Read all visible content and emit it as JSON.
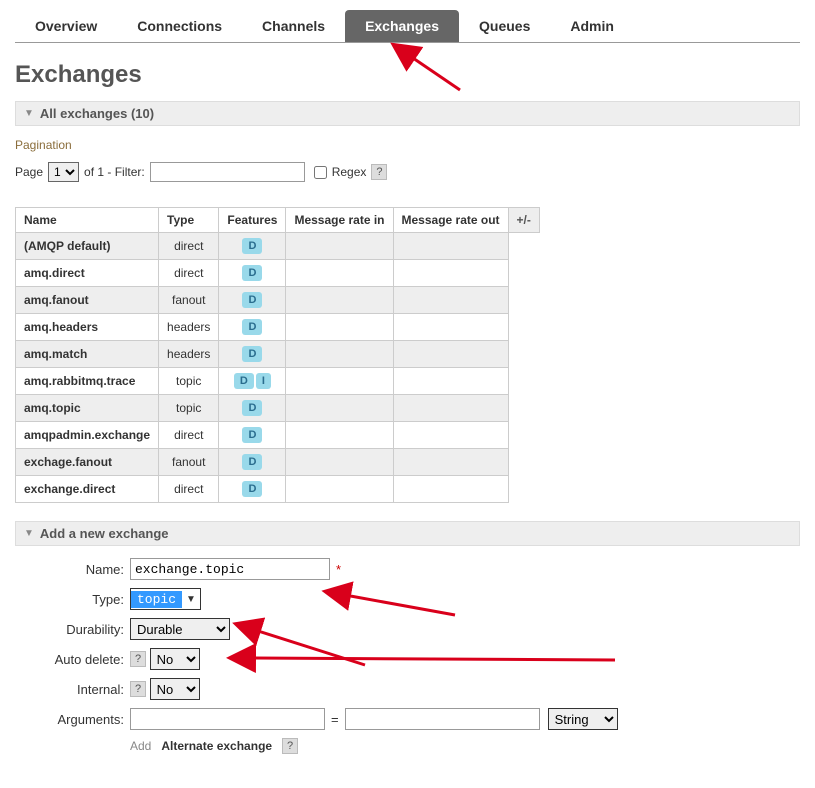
{
  "tabs": {
    "overview": "Overview",
    "connections": "Connections",
    "channels": "Channels",
    "exchanges": "Exchanges",
    "queues": "Queues",
    "admin": "Admin"
  },
  "page_title": "Exchanges",
  "section_all": "All exchanges (10)",
  "pagination_label": "Pagination",
  "page_word": "Page",
  "page_select": "1",
  "of_text": "of 1  - Filter:",
  "regex_label": "Regex",
  "regex_help": "?",
  "table": {
    "headers": {
      "name": "Name",
      "type": "Type",
      "features": "Features",
      "rate_in": "Message rate in",
      "rate_out": "Message rate out",
      "pm": "+/-"
    },
    "rows": [
      {
        "name": "(AMQP default)",
        "type": "direct",
        "features": [
          "D"
        ],
        "odd": true
      },
      {
        "name": "amq.direct",
        "type": "direct",
        "features": [
          "D"
        ],
        "odd": false
      },
      {
        "name": "amq.fanout",
        "type": "fanout",
        "features": [
          "D"
        ],
        "odd": true
      },
      {
        "name": "amq.headers",
        "type": "headers",
        "features": [
          "D"
        ],
        "odd": false
      },
      {
        "name": "amq.match",
        "type": "headers",
        "features": [
          "D"
        ],
        "odd": true
      },
      {
        "name": "amq.rabbitmq.trace",
        "type": "topic",
        "features": [
          "D",
          "I"
        ],
        "odd": false
      },
      {
        "name": "amq.topic",
        "type": "topic",
        "features": [
          "D"
        ],
        "odd": true
      },
      {
        "name": "amqpadmin.exchange",
        "type": "direct",
        "features": [
          "D"
        ],
        "odd": false
      },
      {
        "name": "exchage.fanout",
        "type": "fanout",
        "features": [
          "D"
        ],
        "odd": true
      },
      {
        "name": "exchange.direct",
        "type": "direct",
        "features": [
          "D"
        ],
        "odd": false
      }
    ]
  },
  "section_add": "Add a new exchange",
  "form": {
    "name_label": "Name:",
    "name_value": "exchange.topic",
    "type_label": "Type:",
    "type_value": "topic",
    "durability_label": "Durability:",
    "durability_value": "Durable",
    "autodelete_label": "Auto delete:",
    "autodelete_help": "?",
    "autodelete_value": "No",
    "internal_label": "Internal:",
    "internal_help": "?",
    "internal_value": "No",
    "arguments_label": "Arguments:",
    "arg_eq": "=",
    "arg_type": "String",
    "add_text": "Add",
    "alt_exchange": "Alternate exchange",
    "alt_help": "?"
  }
}
